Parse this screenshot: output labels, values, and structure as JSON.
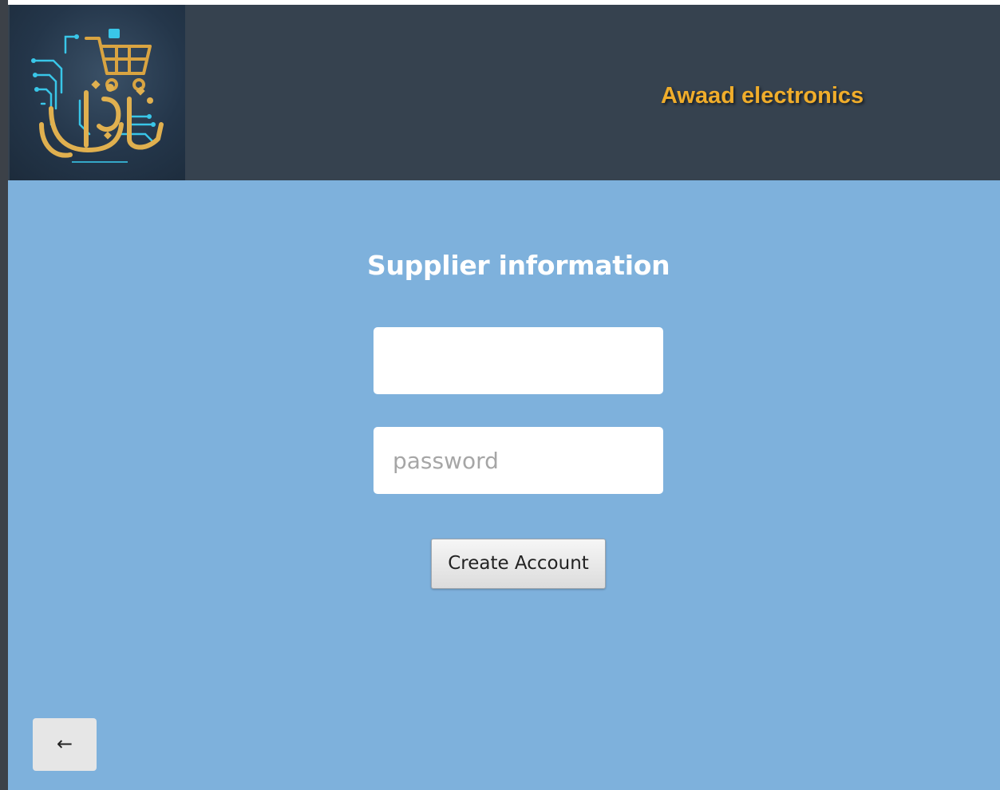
{
  "header": {
    "brand_name": "Awaad electronics",
    "logo_icon": "cart-circuit-logo-icon"
  },
  "form": {
    "title": "Supplier information",
    "username": {
      "value": "",
      "placeholder": ""
    },
    "password": {
      "value": "",
      "placeholder": "password"
    },
    "submit_label": "Create Account"
  },
  "nav": {
    "back_label": "←",
    "back_icon": "arrow-left-icon"
  },
  "colors": {
    "header_bg": "#36424f",
    "content_bg": "#7eb1dc",
    "brand_text": "#f0ad2b",
    "title_text": "#ffffff",
    "logo_gold": "#d9a441",
    "logo_cyan": "#39c6e8"
  }
}
